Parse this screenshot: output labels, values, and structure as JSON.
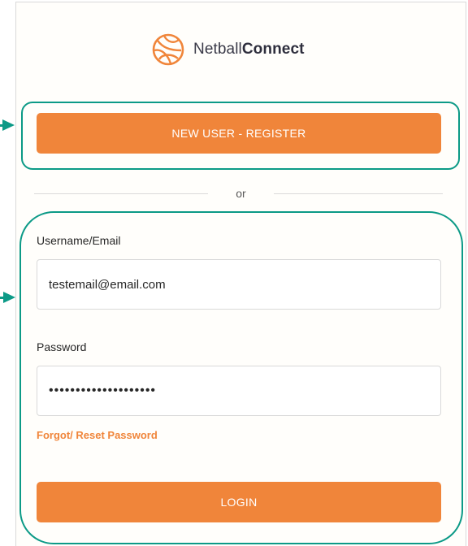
{
  "brand": {
    "name_regular": "Netball",
    "name_bold": "Connect",
    "accent_color": "#f0853a",
    "callout_color": "#0c9a87"
  },
  "register": {
    "label": "NEW USER - REGISTER"
  },
  "divider": {
    "text": "or"
  },
  "form": {
    "username_label": "Username/Email",
    "username_value": "testemail@email.com",
    "password_label": "Password",
    "password_value": "••••••••••••••••••••",
    "forgot_label": "Forgot/ Reset Password",
    "login_label": "LOGIN"
  },
  "icons": {
    "logo": "netball-icon"
  }
}
